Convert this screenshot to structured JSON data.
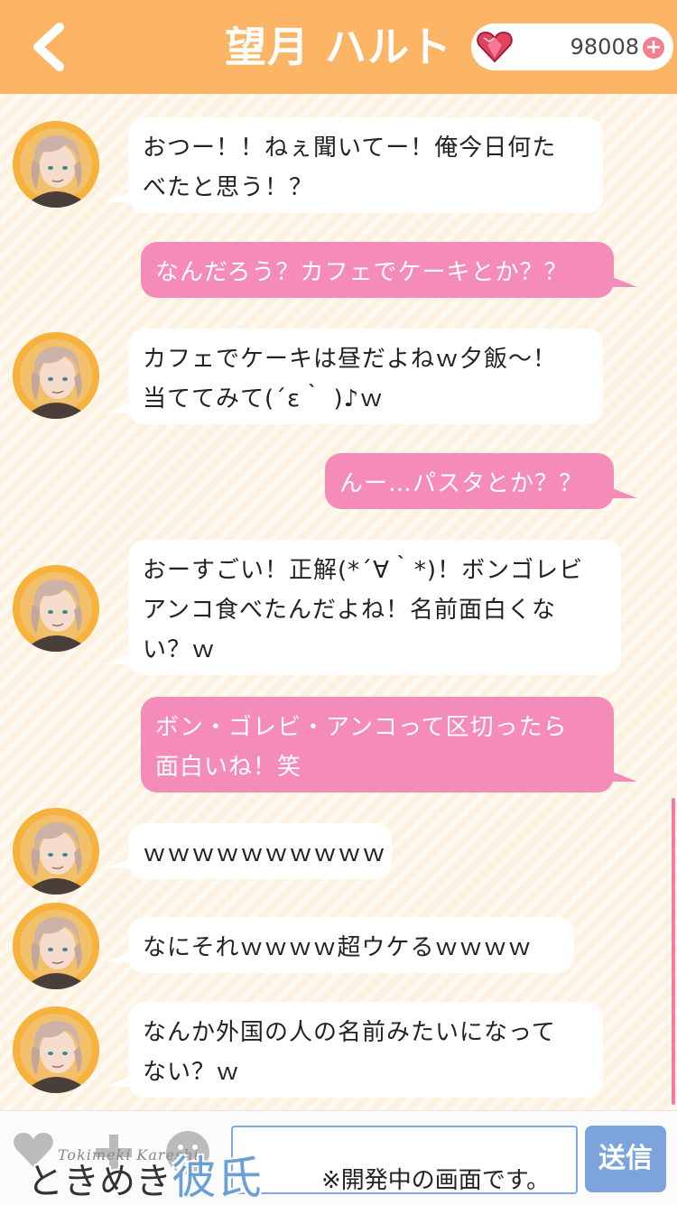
{
  "header": {
    "title": "望月 ハルト",
    "gem_count": "98008",
    "back_icon": "chevron-left-icon",
    "gem_icon": "heart-gem-icon",
    "plus_icon": "plus-circle-icon",
    "accent_color": "#fbb565"
  },
  "messages": [
    {
      "from": "them",
      "lines": [
        "おつー！！ねぇ聞いてー！俺今日何た",
        "べたと思う！？"
      ]
    },
    {
      "from": "me",
      "lines": [
        "なんだろう？カフェでケーキとか？？"
      ]
    },
    {
      "from": "them",
      "lines": [
        "カフェでケーキは昼だよねｗ夕飯〜！",
        "当ててみて(´ε｀ )♪ｗ"
      ]
    },
    {
      "from": "me",
      "lines": [
        "んー…パスタとか？？"
      ]
    },
    {
      "from": "them",
      "lines": [
        "おーすごい！正解(*´∀｀*)！ボンゴレビ",
        "アンコ食べたんだよね！名前面白くな",
        "い？ｗ"
      ]
    },
    {
      "from": "me",
      "lines": [
        "ボン・ゴレビ・アンコって区切ったら",
        "面白いね！笑"
      ]
    },
    {
      "from": "them",
      "lines": [
        "ｗｗｗｗｗｗｗｗｗｗ"
      ]
    },
    {
      "from": "them",
      "lines": [
        "なにそれｗｗｗｗ超ウケるｗｗｗｗ"
      ]
    },
    {
      "from": "them",
      "lines": [
        "なんか外国の人の名前みたいになって",
        "ない？ｗ"
      ]
    }
  ],
  "colors": {
    "my_bubble": "#f48bb8",
    "their_bubble": "#ffffff",
    "avatar_ring": "#f6b23d",
    "send_button": "#7da3dc"
  },
  "input_bar": {
    "heart_icon": "heart-icon",
    "add_icon": "plus-icon",
    "smile_icon": "smile-icon",
    "input_value": "",
    "send_label": "送信"
  },
  "footer": {
    "logo_sub": "Tokimeki Kareshi",
    "logo_text_a": "ときめき",
    "logo_text_b": "彼氏",
    "dev_notice": "※開発中の画面です。"
  }
}
